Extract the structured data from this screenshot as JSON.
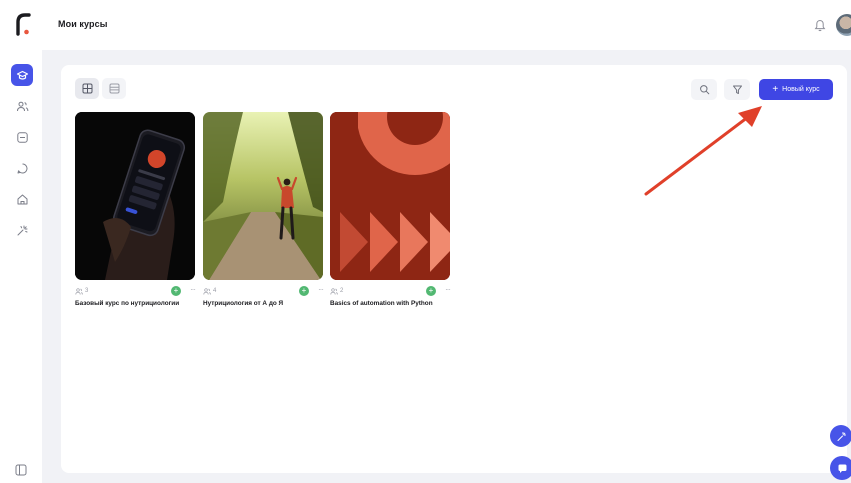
{
  "header": {
    "title": "Мои курсы"
  },
  "toolbar": {
    "new_course_label": "Новый курс"
  },
  "courses": [
    {
      "title": "Базовый курс по нутрициологии",
      "students": "3"
    },
    {
      "title": "Нутрициология от А до Я",
      "students": "4"
    },
    {
      "title": "Basics of automation with Python",
      "students": "2"
    }
  ],
  "colors": {
    "accent": "#4754e8",
    "button": "#3f46e4",
    "status": "#52b872",
    "annotation_arrow": "#e0402a"
  },
  "icons": {
    "sidebar": [
      "courses-icon",
      "users-icon",
      "assignments-icon",
      "chat-icon",
      "home-icon",
      "automation-icon"
    ],
    "toolbar": [
      "grid-view-icon",
      "list-view-icon",
      "search-icon",
      "filter-icon",
      "plus-icon"
    ]
  }
}
